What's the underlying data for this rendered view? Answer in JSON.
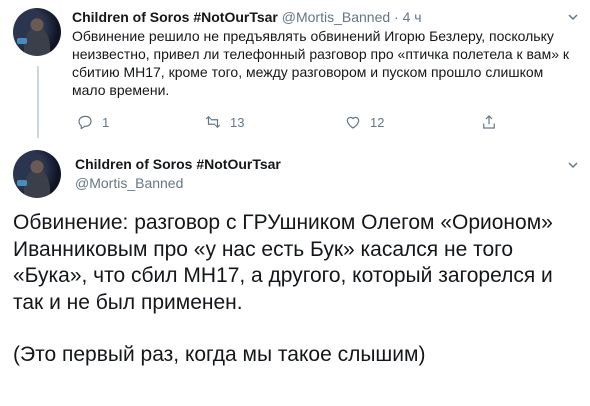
{
  "reply_tweet": {
    "display_name": "Children of Soros #NotOurTsar",
    "handle": "@Mortis_Banned",
    "separator": "·",
    "time": "4 ч",
    "text": "Обвинение решило не предъявлять обвинений Игорю Безлеру, поскольку неизвестно, привел ли телефонный разговор про «птичка полетела к вам» к сбитию МН17, кроме того, между разговором и пуском прошло слишком мало времени.",
    "actions": {
      "reply_count": "1",
      "retweet_count": "13",
      "like_count": "12"
    }
  },
  "main_tweet": {
    "display_name": "Children of Soros #NotOurTsar",
    "handle": "@Mortis_Banned",
    "paragraph_1": "Обвинение: разговор с ГРУшником Олегом «Орионом» Иванниковым про «у нас есть Бук» касался не того «Бука», что сбил МН17, а другого, который загорелся и так и не был применен.",
    "paragraph_2": "(Это первый раз, когда мы такое слышим)"
  },
  "icons": {
    "reply": "reply-icon",
    "retweet": "retweet-icon",
    "like": "heart-icon",
    "share": "share-icon",
    "more": "chevron-down-icon"
  },
  "colors": {
    "text": "#14171a",
    "secondary": "#657786",
    "thread_line": "#ccd6dd"
  }
}
